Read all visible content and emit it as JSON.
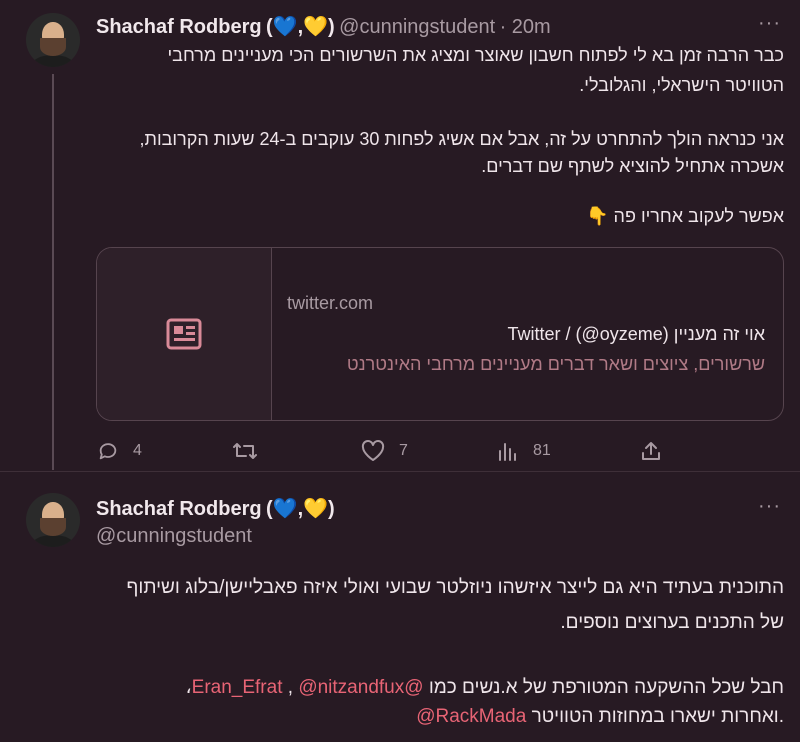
{
  "tweet1": {
    "author_name": "Shachaf Rodberg",
    "emojis": "(💙,💛)",
    "handle": "@cunningstudent",
    "time": "· 20m",
    "line1": "כבר הרבה זמן בא לי לפתוח חשבון שאוצר ומציג את השרשורים הכי מעניינים מרחבי",
    "line2": "הטוויטר הישראלי, והגלובלי.",
    "line3": "אני כנראה הולך להתחרט על זה, אבל אם אשיג לפחות 30 עוקבים ב-24 שעות הקרובות,",
    "line4": "אשכרה אתחיל להוציא לשתף שם דברים.",
    "line5": "אפשר לעקוב אחריו פה 👇",
    "card": {
      "domain": "twitter.com",
      "title": "אוי זה מעניין (oyzeme@) / Twitter",
      "description": "שרשורים, ציוצים ושאר דברים מעניינים מרחבי האינטרנט",
      "icon": "article-icon"
    },
    "actions": {
      "reply_count": "4",
      "retweet_count": "",
      "like_count": "7",
      "views_count": "81"
    }
  },
  "tweet2": {
    "author_name": "Shachaf Rodberg",
    "emojis": "(💙,💛)",
    "handle": "@cunningstudent",
    "line1": "התוכנית בעתיד היא גם לייצר איזשהו ניוזלטר שבועי ואולי איזה פאבליישן/בלוג ושיתוף",
    "line2": "של התכנים בערוצים נוספים.",
    "line3_text": "חבל שכל ההשקעה המטורפת של א.נשים כמו",
    "mention1": "@Eran_Efrat",
    "comma1": " ,",
    "mention2": "@nitzandfux",
    "comma2": "،",
    "mention3": "@RackMada",
    "line4_text": "ואחרות ישארו במחוזות הטוויטר."
  },
  "colors": {
    "background": "#271a23",
    "muted": "#a89aa2",
    "mention": "#e86475",
    "card_desc": "#b07a86"
  }
}
